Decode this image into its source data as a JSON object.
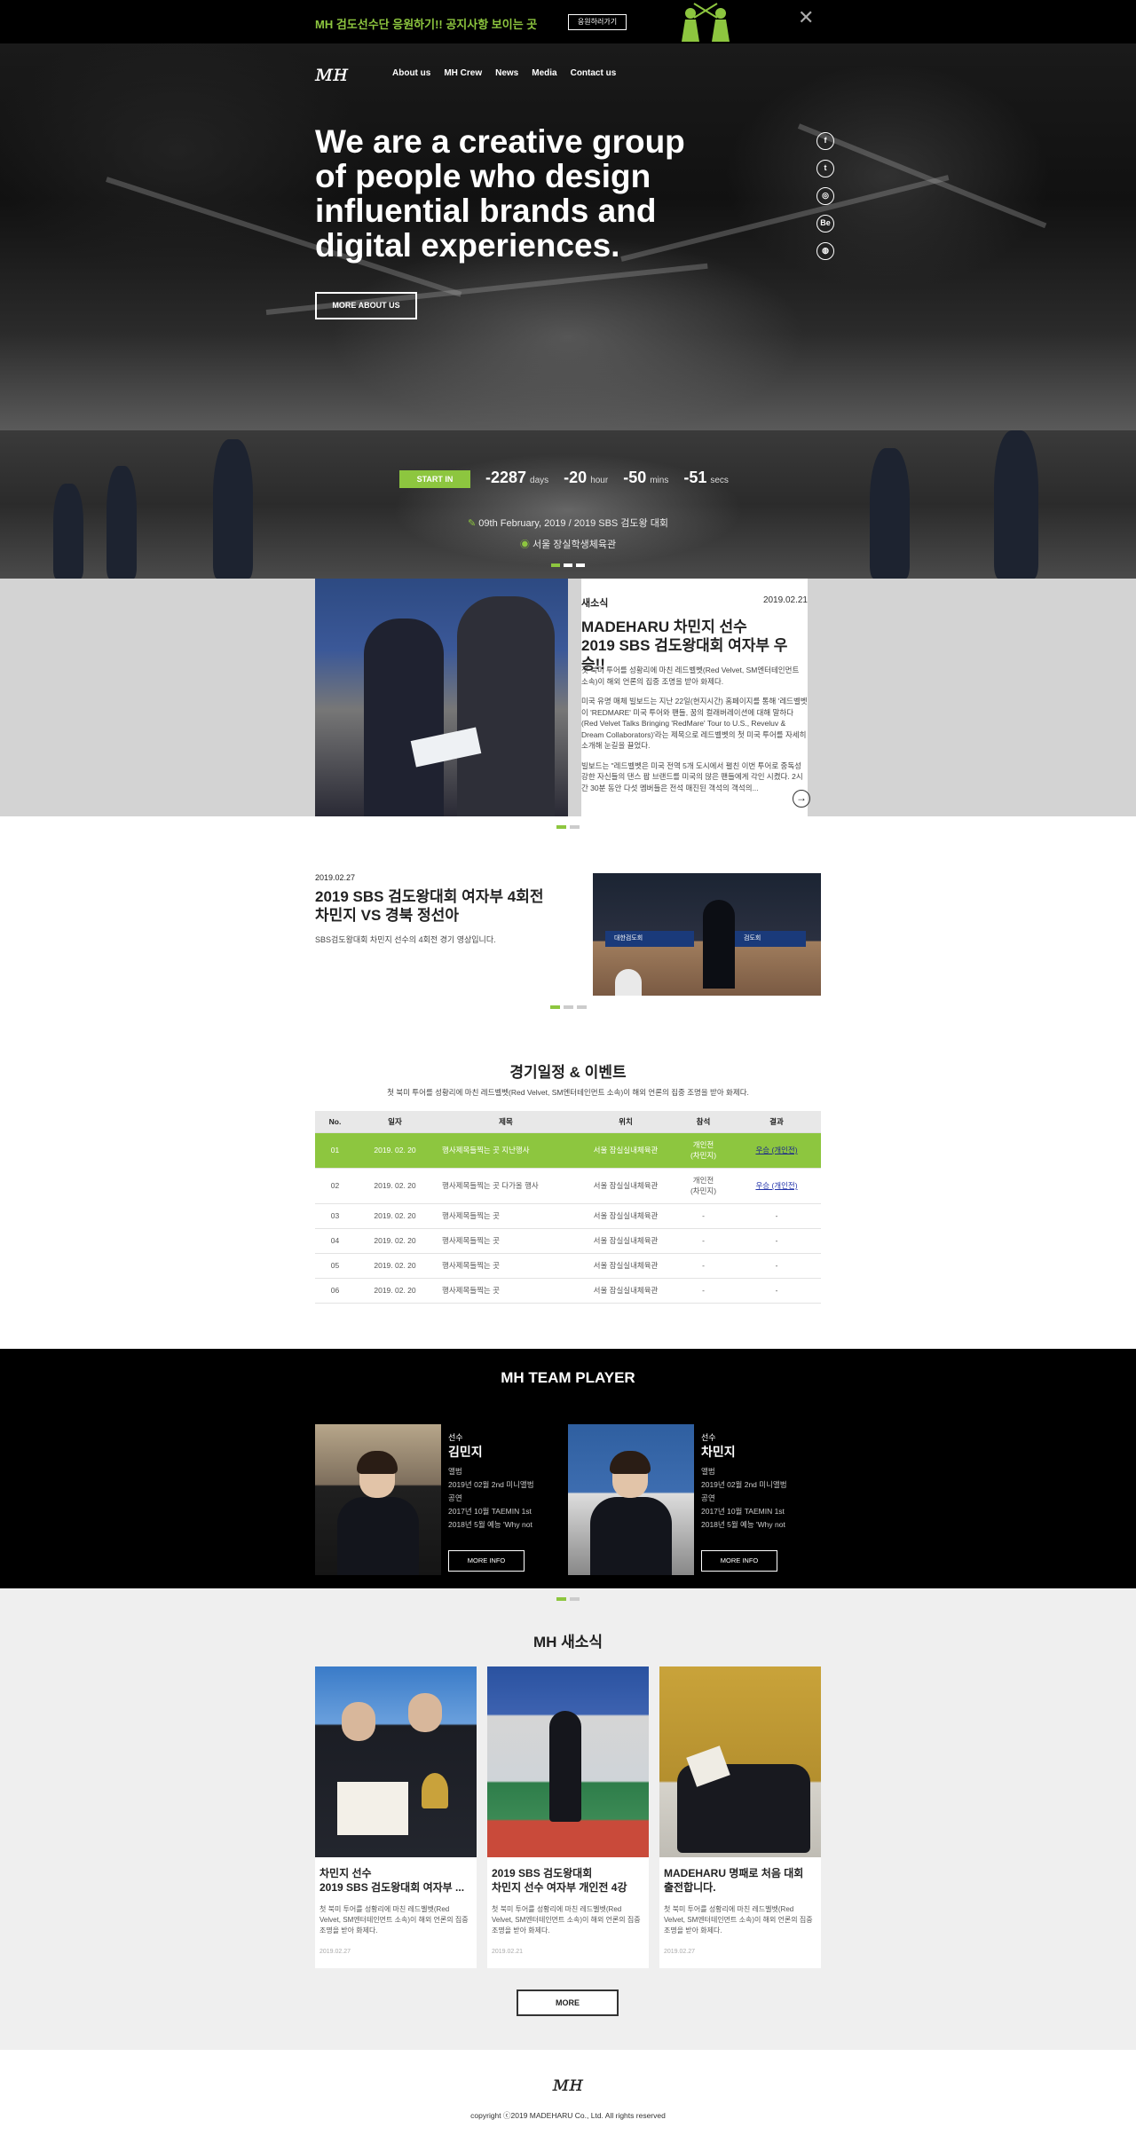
{
  "banner": {
    "message": "MH 검도선수단 응원하기!! 공지사항 보이는 곳",
    "button": "응원하러가기",
    "close": "✕"
  },
  "header": {
    "logo": "ᴍʜ",
    "nav": [
      "About us",
      "MH Crew",
      "News",
      "Media",
      "Contact us"
    ]
  },
  "hero": {
    "headline": "We are a creative group of people who design influential brands and digital experiences.",
    "button": "MORE ABOUT US"
  },
  "social": [
    {
      "icon": "facebook-icon",
      "glyph": "f"
    },
    {
      "icon": "twitter-icon",
      "glyph": "t"
    },
    {
      "icon": "instagram-icon",
      "glyph": "◎"
    },
    {
      "icon": "behance-icon",
      "glyph": "Be"
    },
    {
      "icon": "dribbble-icon",
      "glyph": "◍"
    }
  ],
  "countdown": {
    "label": "START IN",
    "days": "-2287",
    "days_unit": "days",
    "hours": "-20",
    "hours_unit": "hour",
    "mins": "-50",
    "mins_unit": "mins",
    "secs": "-51",
    "secs_unit": "secs",
    "date": "09th February, 2019 / 2019 SBS 검도왕 대회",
    "place": "서울 장실학생체육관"
  },
  "news_slide": {
    "category": "새소식",
    "date": "2019.02.21",
    "title_line1": "MADEHARU 차민지 선수",
    "title_line2": "2019 SBS 검도왕대회 여자부 우승!!",
    "p1": "첫 북미 투어를 성황리에 마친 레드벨벳(Red Velvet, SM엔터테인먼트 소속)이 해외 언론의 집중 조명을 받아 화제다.",
    "p2": "미국 유명 매체 빌보드는 지난 22일(현지시간) 홈페이지를 통해 '레드벨벳이 'REDMARE' 미국 투어와 팬들, 꿈의 컬래버레이션에 대해 말하다(Red Velvet Talks Bringing 'RedMare' Tour to U.S., Reveluv & Dream Collaborators)'라는 제목으로 레드벨벳의 첫 미국 투어를 자세히 소개해 눈길을 끌었다.",
    "p3": "빌보드는 \"레드벨벳은 미국 전역 5개 도시에서 펼친 이번 투어로 중독성 강한 자신들의 댄스 팝 브랜드를 미국의 많은 팬들에게 각인 시켰다. 2시간 30분 동안 다섯 멤버들은 전석 매진된 객석의 객석의..."
  },
  "video": {
    "date": "2019.02.27",
    "title_line1": "2019 SBS 검도왕대회 여자부 4회전",
    "title_line2": "차민지 VS 경북 정선아",
    "desc": "SBS검도왕대회 차민지 선수의 4회전 경기 영상입니다.",
    "banner_left": "대한검도회",
    "banner_right": "검도회"
  },
  "schedule": {
    "title": "경기일정 & 이벤트",
    "subtitle": "첫 북미 투어를 성황리에 마친 레드벨벳(Red Velvet, SM엔터테인먼트 소속)이 해외 언론의 집중 조명을 받아 화제다.",
    "headers": [
      "No.",
      "일자",
      "제목",
      "위치",
      "참석",
      "결과"
    ],
    "rows": [
      [
        "01",
        "2019. 02. 20",
        "행사제목들찍는 곳 지난행사",
        "서울 잠실실내체육관",
        "개인전\n(차민지)",
        "우승 (개인전)"
      ],
      [
        "02",
        "2019. 02. 20",
        "행사제목들찍는 곳 다가올 행사",
        "서울 잠실실내체육관",
        "개인전\n(차민지)",
        "우승 (개인전)"
      ],
      [
        "03",
        "2019. 02. 20",
        "행사제목들찍는 곳",
        "서울 잠실실내체육관",
        "-",
        "-"
      ],
      [
        "04",
        "2019. 02. 20",
        "행사제목들찍는 곳",
        "서울 잠실실내체육관",
        "-",
        "-"
      ],
      [
        "05",
        "2019. 02. 20",
        "행사제목들찍는 곳",
        "서울 잠실실내체육관",
        "-",
        "-"
      ],
      [
        "06",
        "2019. 02. 20",
        "행사제목들찍는 곳",
        "서울 잠실실내체육관",
        "-",
        "-"
      ]
    ]
  },
  "team": {
    "title": "MH TEAM PLAYER",
    "players": [
      {
        "role": "선수",
        "name": "김민지",
        "l1": "앨범",
        "l2": "2019년 02월 2nd 미니앨범",
        "l3": "공연",
        "l4": "2017년 10월 TAEMIN 1st",
        "l5": "2018년 5월 예능 'Why not",
        "button": "MORE INFO"
      },
      {
        "role": "선수",
        "name": "차민지",
        "l1": "앨범",
        "l2": "2019년 02월 2nd 미니앨범",
        "l3": "공연",
        "l4": "2017년 10월 TAEMIN 1st",
        "l5": "2018년 5월 예능 'Why not",
        "button": "MORE INFO"
      }
    ]
  },
  "mhnews": {
    "title": "MH 새소식",
    "cards": [
      {
        "t1": "차민지 선수",
        "t2": "2019 SBS 검도왕대회 여자부 ...",
        "body": "첫 북미 투어를 성황리에 마친 레드벨벳(Red Velvet, SM엔터테인먼트 소속)이 해외 언론의 집중 조명을 받아 화제다.",
        "date": "2019.02.27"
      },
      {
        "t1": "2019 SBS 검도왕대회",
        "t2": "차민지 선수 여자부 개인전 4강",
        "body": "첫 북미 투어를 성황리에 마친 레드벨벳(Red Velvet, SM엔터테인먼트 소속)이 해외 언론의 집중 조명을 받아 화제다.",
        "date": "2019.02.21"
      },
      {
        "t1": "MADEHARU 명패로 처음 대회",
        "t2": "출전합니다.",
        "body": "첫 북미 투어를 성황리에 마친 레드벨벳(Red Velvet, SM엔터테인먼트 소속)이 해외 언론의 집중 조명을 받아 화제다.",
        "date": "2019.02.27"
      }
    ],
    "more": "MORE"
  },
  "footer": {
    "logo": "ᴍʜ",
    "copyright": "copyright ⓒ2019 MADEHARU Co., Ltd. All rights reserved"
  },
  "colors": {
    "accent": "#8dc63f",
    "dark": "#000000"
  }
}
